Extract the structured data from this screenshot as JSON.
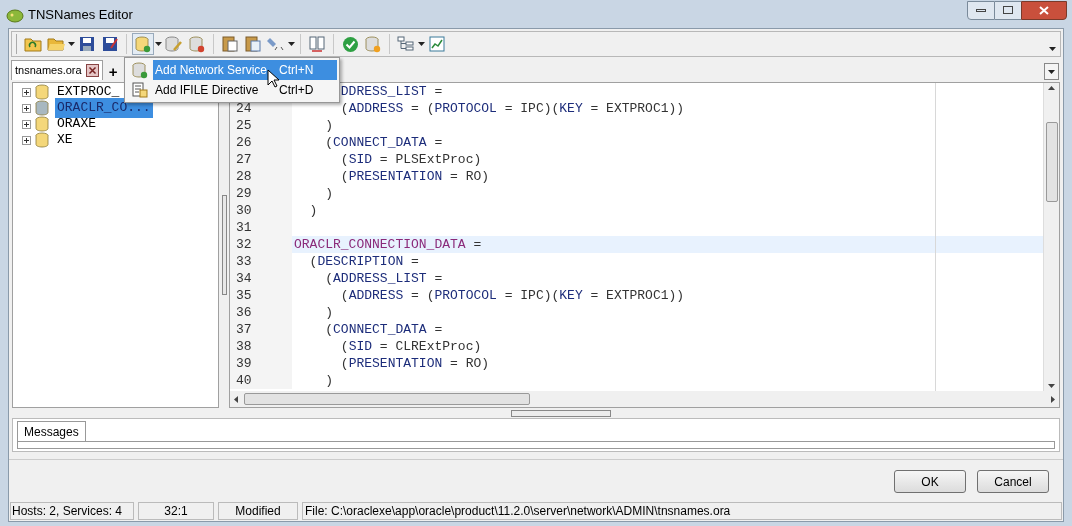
{
  "window": {
    "title": "TNSNames Editor"
  },
  "file_tabs": [
    {
      "label": "tnsnames.ora",
      "selected": true
    }
  ],
  "new_tab": "+",
  "menu": [
    {
      "label": "Add Network Service",
      "shortcut": "Ctrl+N",
      "selected": true,
      "kind": "service"
    },
    {
      "label": "Add IFILE Directive",
      "shortcut": "Ctrl+D",
      "selected": false,
      "kind": "directive"
    }
  ],
  "tree": [
    {
      "label": "EXTPROC_",
      "selected": false,
      "expanded": false
    },
    {
      "label": "ORACLR_CO...",
      "selected": true,
      "expanded": false
    },
    {
      "label": "ORAXE",
      "selected": false,
      "expanded": false
    },
    {
      "label": "XE",
      "selected": false,
      "expanded": false
    }
  ],
  "editor": {
    "lines": [
      {
        "current": false,
        "tokens": [
          {
            "t": "      DDRESS_LIST",
            "kind": "kw"
          },
          {
            "t": " =",
            "kind": "op"
          }
        ]
      },
      {
        "number": "24",
        "current": false,
        "tokens": [
          {
            "t": "      (",
            "kind": "op"
          },
          {
            "t": "ADDRESS",
            "kind": "kw"
          },
          {
            "t": " = (",
            "kind": "op"
          },
          {
            "t": "PROTOCOL",
            "kind": "kw"
          },
          {
            "t": " = IPC)(",
            "kind": "op"
          },
          {
            "t": "KEY",
            "kind": "kw"
          },
          {
            "t": " = EXTPROC1))",
            "kind": "op"
          }
        ]
      },
      {
        "number": "25",
        "current": false,
        "tokens": [
          {
            "t": "    )",
            "kind": "op"
          }
        ]
      },
      {
        "number": "26",
        "current": false,
        "tokens": [
          {
            "t": "    (",
            "kind": "op"
          },
          {
            "t": "CONNECT_DATA",
            "kind": "kw"
          },
          {
            "t": " =",
            "kind": "op"
          }
        ]
      },
      {
        "number": "27",
        "current": false,
        "tokens": [
          {
            "t": "      (",
            "kind": "op"
          },
          {
            "t": "SID",
            "kind": "kw"
          },
          {
            "t": " = PLSExtProc)",
            "kind": "op"
          }
        ]
      },
      {
        "number": "28",
        "current": false,
        "tokens": [
          {
            "t": "      (",
            "kind": "op"
          },
          {
            "t": "PRESENTATION",
            "kind": "kw"
          },
          {
            "t": " = RO)",
            "kind": "op"
          }
        ]
      },
      {
        "number": "29",
        "current": false,
        "tokens": [
          {
            "t": "    )",
            "kind": "op"
          }
        ]
      },
      {
        "number": "30",
        "current": false,
        "tokens": [
          {
            "t": "  )",
            "kind": "op"
          }
        ]
      },
      {
        "number": "31",
        "current": false
      },
      {
        "number": "32",
        "current": true,
        "tokens": [
          {
            "t": "ORACLR_CONNECTION_DATA",
            "kind": "name"
          },
          {
            "t": " =",
            "kind": "op"
          }
        ]
      },
      {
        "number": "33",
        "current": false,
        "tokens": [
          {
            "t": "  (",
            "kind": "op"
          },
          {
            "t": "DESCRIPTION",
            "kind": "kw"
          },
          {
            "t": " =",
            "kind": "op"
          }
        ]
      },
      {
        "number": "34",
        "current": false,
        "tokens": [
          {
            "t": "    (",
            "kind": "op"
          },
          {
            "t": "ADDRESS_LIST",
            "kind": "kw"
          },
          {
            "t": " =",
            "kind": "op"
          }
        ]
      },
      {
        "number": "35",
        "current": false,
        "tokens": [
          {
            "t": "      (",
            "kind": "op"
          },
          {
            "t": "ADDRESS",
            "kind": "kw"
          },
          {
            "t": " = (",
            "kind": "op"
          },
          {
            "t": "PROTOCOL",
            "kind": "kw"
          },
          {
            "t": " = IPC)(",
            "kind": "op"
          },
          {
            "t": "KEY",
            "kind": "kw"
          },
          {
            "t": " = EXTPROC1))",
            "kind": "op"
          }
        ]
      },
      {
        "number": "36",
        "current": false,
        "tokens": [
          {
            "t": "    )",
            "kind": "op"
          }
        ]
      },
      {
        "number": "37",
        "current": false,
        "tokens": [
          {
            "t": "    (",
            "kind": "op"
          },
          {
            "t": "CONNECT_DATA",
            "kind": "kw"
          },
          {
            "t": " =",
            "kind": "op"
          }
        ]
      },
      {
        "number": "38",
        "current": false,
        "tokens": [
          {
            "t": "      (",
            "kind": "op"
          },
          {
            "t": "SID",
            "kind": "kw"
          },
          {
            "t": " = CLRExtProc)",
            "kind": "op"
          }
        ]
      },
      {
        "number": "39",
        "current": false,
        "tokens": [
          {
            "t": "      (",
            "kind": "op"
          },
          {
            "t": "PRESENTATION",
            "kind": "kw"
          },
          {
            "t": " = RO)",
            "kind": "op"
          }
        ]
      },
      {
        "number": "40",
        "current": false,
        "tokens": [
          {
            "t": "    )",
            "kind": "op"
          }
        ]
      }
    ]
  },
  "bottom_tabs": [
    {
      "label": "Messages",
      "selected": true
    }
  ],
  "buttons": [
    "OK",
    "Cancel"
  ],
  "status_bar": {
    "hosts": "Hosts: 2, Services: 4",
    "position": "32:1",
    "state": "Modified",
    "file": "File: C:\\oraclexe\\app\\oracle\\product\\11.2.0\\server\\network\\ADMIN\\tnsnames.ora"
  }
}
